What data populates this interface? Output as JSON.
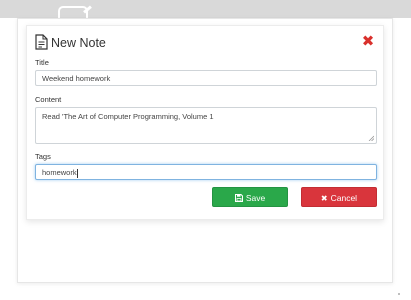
{
  "modal": {
    "title": "New Note",
    "close_icon": "close-icon",
    "note_icon": "document-edit-icon"
  },
  "fields": {
    "title": {
      "label": "Title",
      "value": "Weekend homework"
    },
    "content": {
      "label": "Content",
      "value": "Read 'The Art of Computer Programming, Volume 1"
    },
    "tags": {
      "label": "Tags",
      "value": "homework"
    }
  },
  "buttons": {
    "save": {
      "label": "Save",
      "icon": "floppy-disk-icon",
      "color": "#2aa84a"
    },
    "cancel": {
      "label": "Cancel",
      "icon": "close-icon",
      "color": "#d9353c"
    }
  },
  "colors": {
    "close_accent": "#d9302c",
    "header_bar": "#d9d9d9"
  }
}
